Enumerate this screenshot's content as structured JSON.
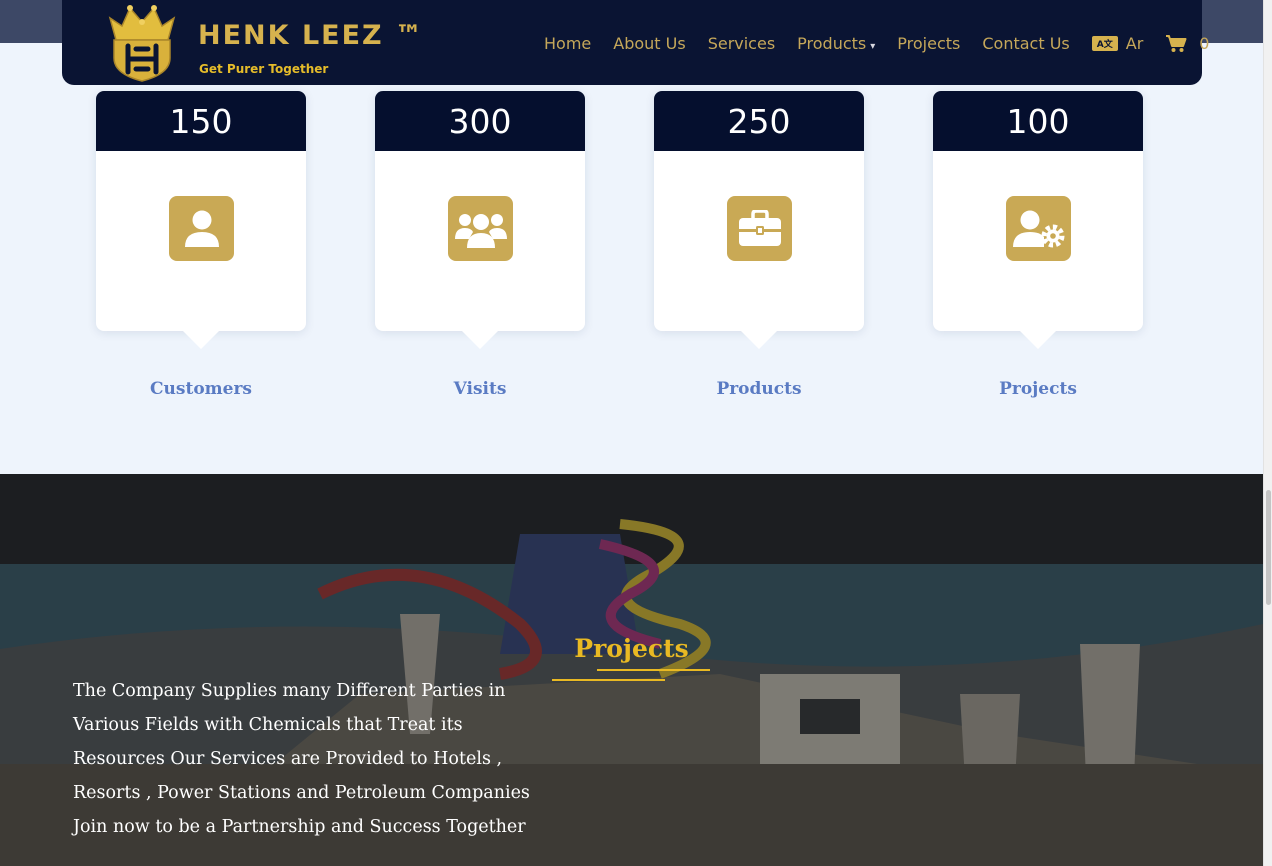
{
  "brand": {
    "name": "HENK LEEZ ™",
    "tagline": "Get Purer Together",
    "colors": {
      "navy": "#0a1433",
      "gold": "#c9a955"
    }
  },
  "nav": {
    "links": [
      "Home",
      "About Us",
      "Services",
      "Products",
      "Projects",
      "Contact Us"
    ],
    "products_caret": "▾",
    "language_label": "Ar",
    "cart_count": "0"
  },
  "stats": [
    {
      "value": "150",
      "label": "Customers",
      "icon": "user-icon"
    },
    {
      "value": "300",
      "label": "Visits",
      "icon": "users-group-icon"
    },
    {
      "value": "250",
      "label": "Products",
      "icon": "briefcase-icon"
    },
    {
      "value": "100",
      "label": "Projects",
      "icon": "user-gear-icon"
    }
  ],
  "projects_section": {
    "title": "Projects",
    "lines": [
      "The Company Supplies many Different Parties in",
      "Various Fields with Chemicals that Treat its",
      "Resources Our Services are Provided to Hotels ,",
      "Resorts , Power Stations and Petroleum Companies",
      "Join now to be a Partnership and Success Together"
    ]
  }
}
